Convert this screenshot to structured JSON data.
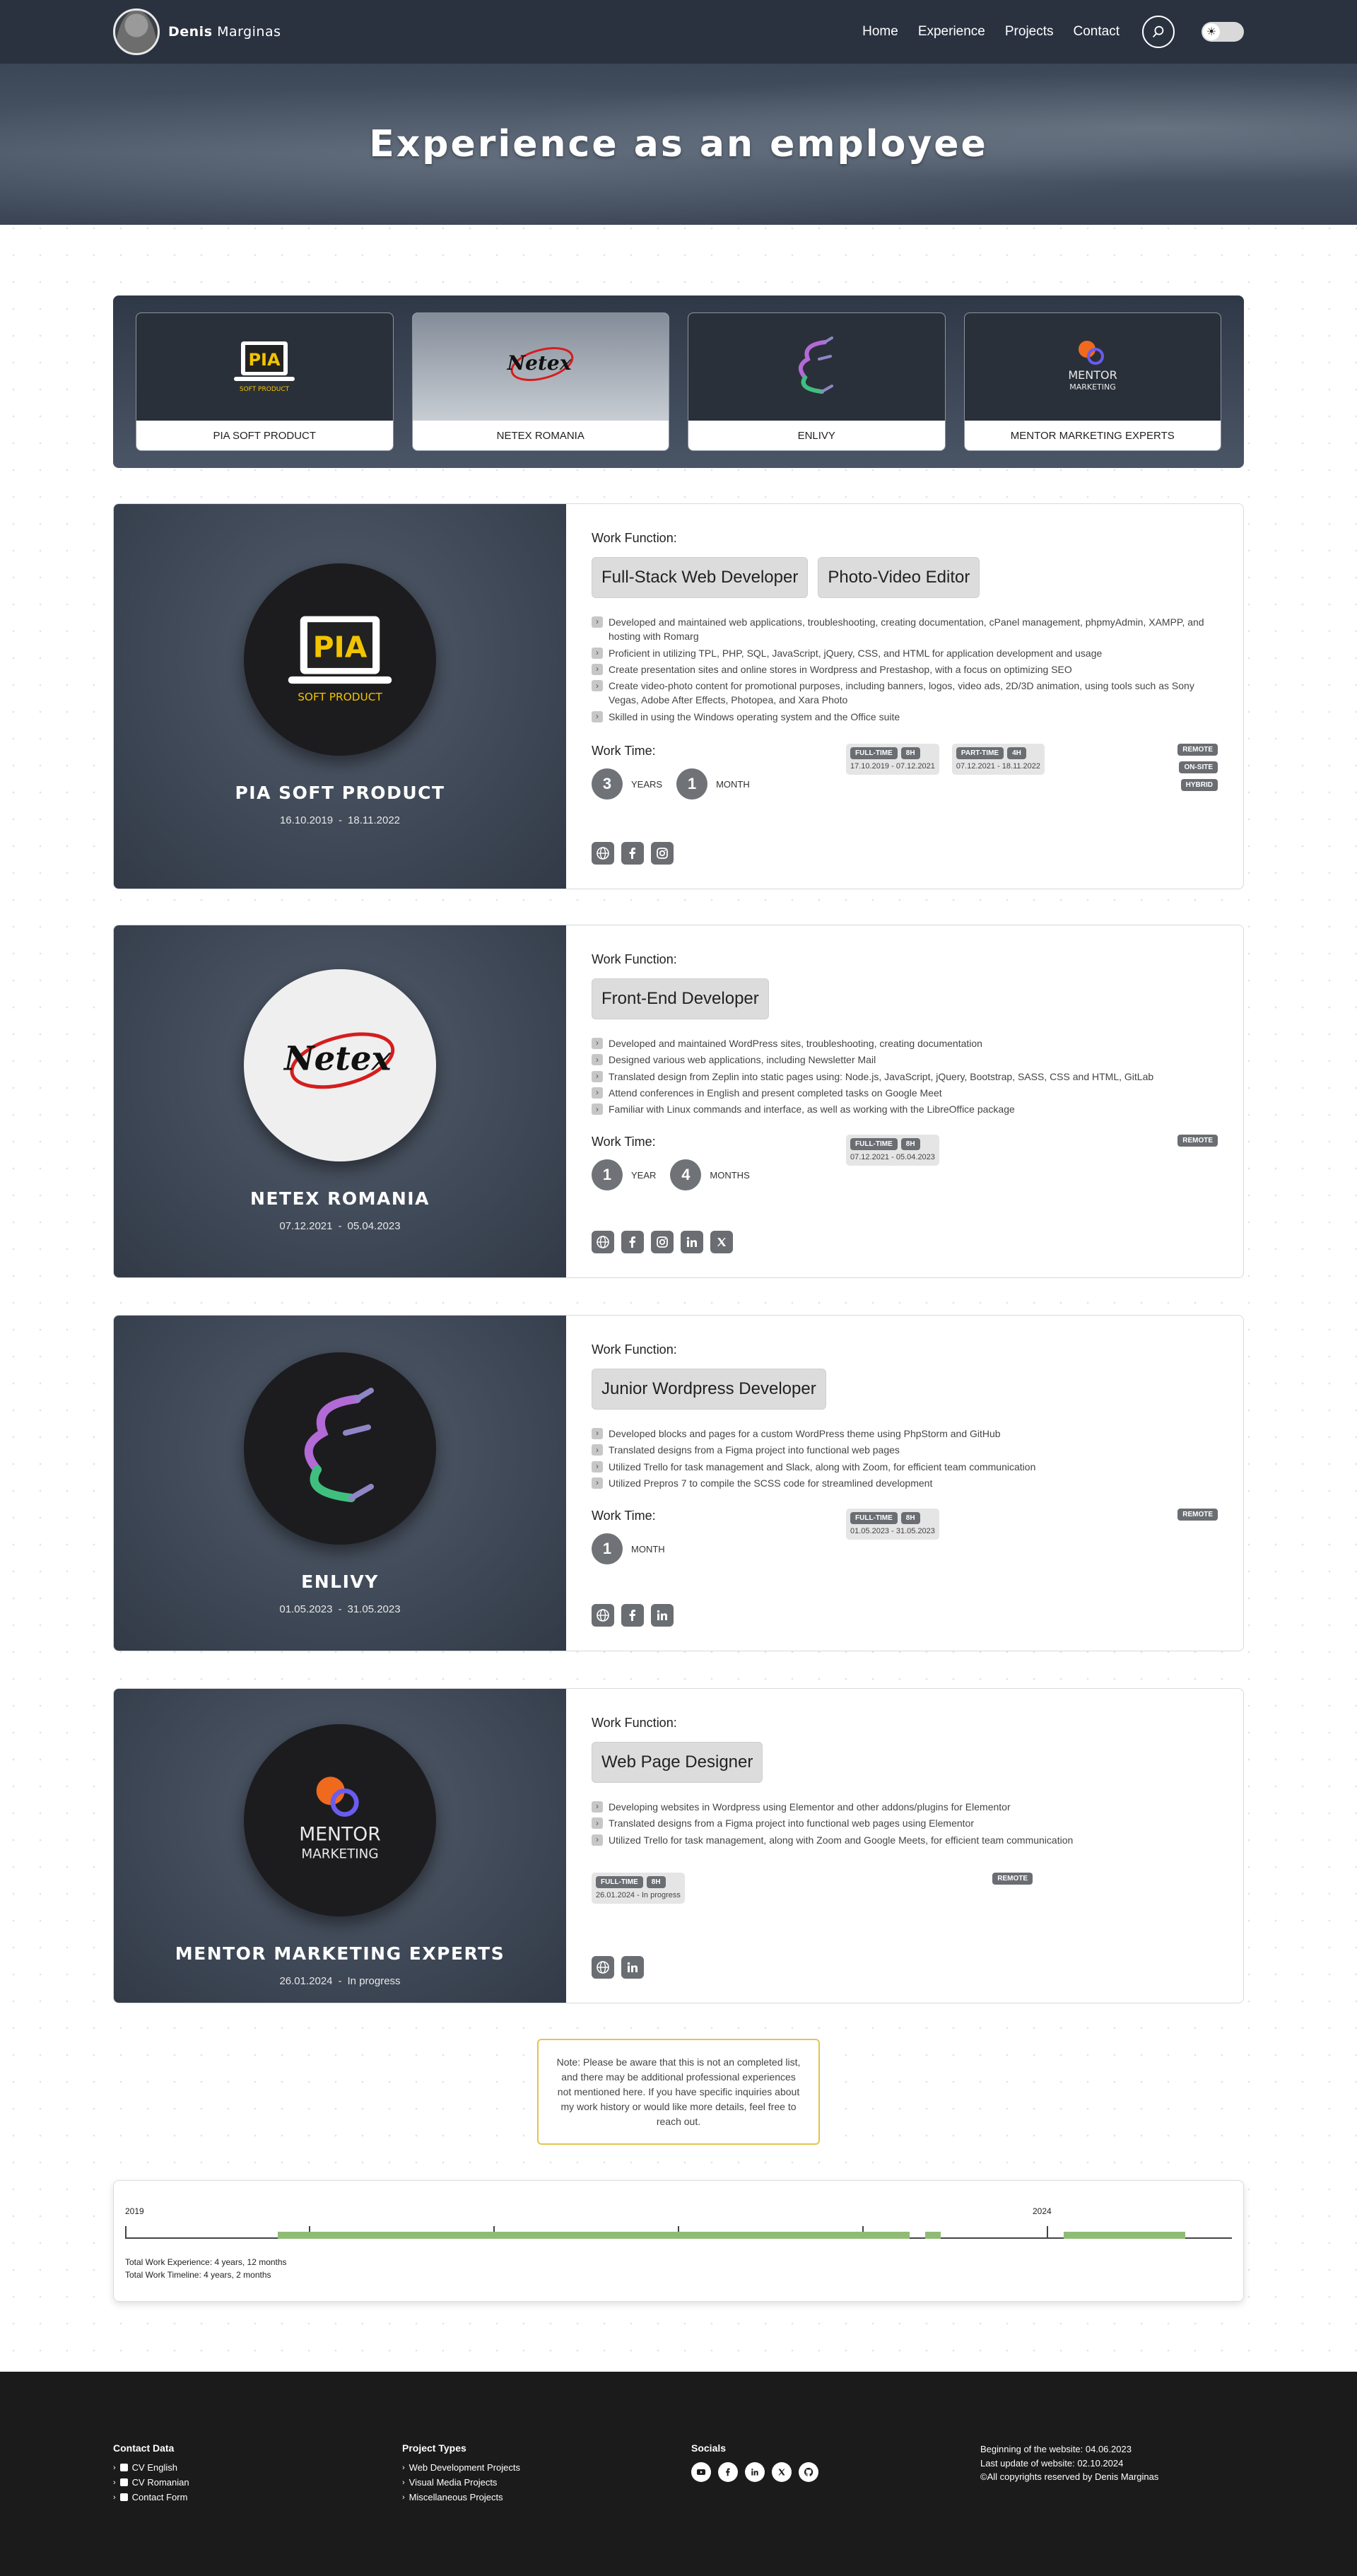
{
  "nav": {
    "brand_first": "Denis",
    "brand_last": "Marginas",
    "links": [
      "Home",
      "Experience",
      "Projects",
      "Contact"
    ],
    "search_icon": "search-icon",
    "theme_icon": "sun-icon"
  },
  "hero": {
    "title": "Experience as an employee"
  },
  "strip": [
    {
      "label": "PIA SOFT PRODUCT"
    },
    {
      "label": "NETEX ROMANIA"
    },
    {
      "label": "ENLIVY"
    },
    {
      "label": "MENTOR MARKETING EXPERTS"
    }
  ],
  "logos": {
    "pia_word": "PIA",
    "pia_sub": "SOFT PRODUCT",
    "netex_word": "Netex",
    "mentor_line1": "MENTOR",
    "mentor_line2": "MARKETING"
  },
  "labels": {
    "work_function": "Work Function:",
    "work_time": "Work Time:",
    "date_sep": "-"
  },
  "jobs": [
    {
      "company": "PIA SOFT PRODUCT",
      "start": "16.10.2019",
      "end": "18.11.2022",
      "roles": [
        "Full-Stack Web Developer",
        "Photo-Video Editor"
      ],
      "duties": [
        "Developed and maintained web applications, troubleshooting, creating documentation, cPanel management, phpmyAdmin, XAMPP, and hosting with Romarg",
        "Proficient in utilizing TPL, PHP, SQL, JavaScript, jQuery, CSS, and HTML for application development and usage",
        "Create presentation sites and online stores in Wordpress and Prestashop, with a focus on optimizing SEO",
        "Create video-photo content for promotional purposes, including banners, logos, video ads, 2D/3D animation, using tools such as Sony Vegas, Adobe After Effects, Photopea, and Xara Photo",
        "Skilled in using the Windows operating system and the Office suite"
      ],
      "time": [
        {
          "num": "3",
          "unit": "YEARS"
        },
        {
          "num": "1",
          "unit": "MONTH"
        }
      ],
      "schedules": [
        {
          "type": "FULL-TIME",
          "hours": "8h",
          "start": "17.10.2019",
          "end": "07.12.2021"
        },
        {
          "type": "PART-TIME",
          "hours": "4h",
          "start": "07.12.2021",
          "end": "18.11.2022"
        }
      ],
      "modes": [
        "REMOTE",
        "ON-SITE",
        "HYBRID"
      ],
      "links": [
        "globe-icon",
        "facebook-icon",
        "instagram-icon"
      ]
    },
    {
      "company": "NETEX ROMANIA",
      "start": "07.12.2021",
      "end": "05.04.2023",
      "roles": [
        "Front-End Developer"
      ],
      "duties": [
        "Developed and maintained WordPress sites, troubleshooting, creating documentation",
        "Designed various web applications, including Newsletter Mail",
        "Translated design from Zeplin into static pages using: Node.js, JavaScript, jQuery, Bootstrap, SASS, CSS and HTML, GitLab",
        "Attend conferences in English and present completed tasks on Google Meet",
        "Familiar with Linux commands and interface, as well as working with the LibreOffice package"
      ],
      "time": [
        {
          "num": "1",
          "unit": "YEAR"
        },
        {
          "num": "4",
          "unit": "MONTHS"
        }
      ],
      "schedules": [
        {
          "type": "FULL-TIME",
          "hours": "8h",
          "start": "07.12.2021",
          "end": "05.04.2023"
        }
      ],
      "modes": [
        "REMOTE"
      ],
      "links": [
        "globe-icon",
        "facebook-icon",
        "instagram-icon",
        "linkedin-icon",
        "x-icon"
      ]
    },
    {
      "company": "ENLIVY",
      "start": "01.05.2023",
      "end": "31.05.2023",
      "roles": [
        "Junior Wordpress Developer"
      ],
      "duties": [
        "Developed blocks and pages for a custom WordPress theme using PhpStorm and GitHub",
        "Translated designs from a Figma project into functional web pages",
        "Utilized Trello for task management and Slack, along with Zoom, for efficient team communication",
        "Utilized Prepros 7 to compile the SCSS code for streamlined development"
      ],
      "time": [
        {
          "num": "1",
          "unit": "MONTH"
        }
      ],
      "schedules": [
        {
          "type": "FULL-TIME",
          "hours": "8h",
          "start": "01.05.2023",
          "end": "31.05.2023"
        }
      ],
      "modes": [
        "REMOTE"
      ],
      "links": [
        "globe-icon",
        "facebook-icon",
        "linkedin-icon"
      ]
    },
    {
      "company": "MENTOR MARKETING EXPERTS",
      "start": "26.01.2024",
      "end": "In progress",
      "roles": [
        "Web Page Designer"
      ],
      "duties": [
        "Developing websites in Wordpress using Elementor and other addons/plugins for Elementor",
        "Translated designs from a Figma project into functional web pages using Elementor",
        "Utilized Trello for task management, along with Zoom and Google Meets, for efficient team communication"
      ],
      "time": [],
      "schedules": [
        {
          "type": "FULL-TIME",
          "hours": "8h",
          "start": "26.01.2024",
          "end": "In progress"
        }
      ],
      "modes": [
        "REMOTE"
      ],
      "links": [
        "globe-icon",
        "linkedin-icon"
      ]
    }
  ],
  "note": "Note: Please be aware that this is not an completed list, and there may be additional professional experiences not mentioned here. If you have specific inquiries about my work history or would like more details, feel free to reach out.",
  "timeline": {
    "year_start": "2019",
    "year_mid": "2024",
    "total_experience": "Total Work Experience: 4 years, 12 months",
    "total_timeline": "Total Work Timeline: 4 years, 2 months"
  },
  "footer": {
    "contact_title": "Contact Data",
    "contact_items": [
      "CV English",
      "CV Romanian",
      "Contact Form"
    ],
    "projects_title": "Project Types",
    "projects_items": [
      "Web Development Projects",
      "Visual Media Projects",
      "Miscellaneous Projects"
    ],
    "socials_title": "Socials",
    "socials": [
      "youtube-icon",
      "facebook-icon",
      "linkedin-icon",
      "x-icon",
      "github-icon"
    ],
    "info": [
      "Beginning of the website: 04.06.2023",
      "Last update of website: 02.10.2024",
      "©All copyrights reserved by Denis Marginas"
    ]
  }
}
